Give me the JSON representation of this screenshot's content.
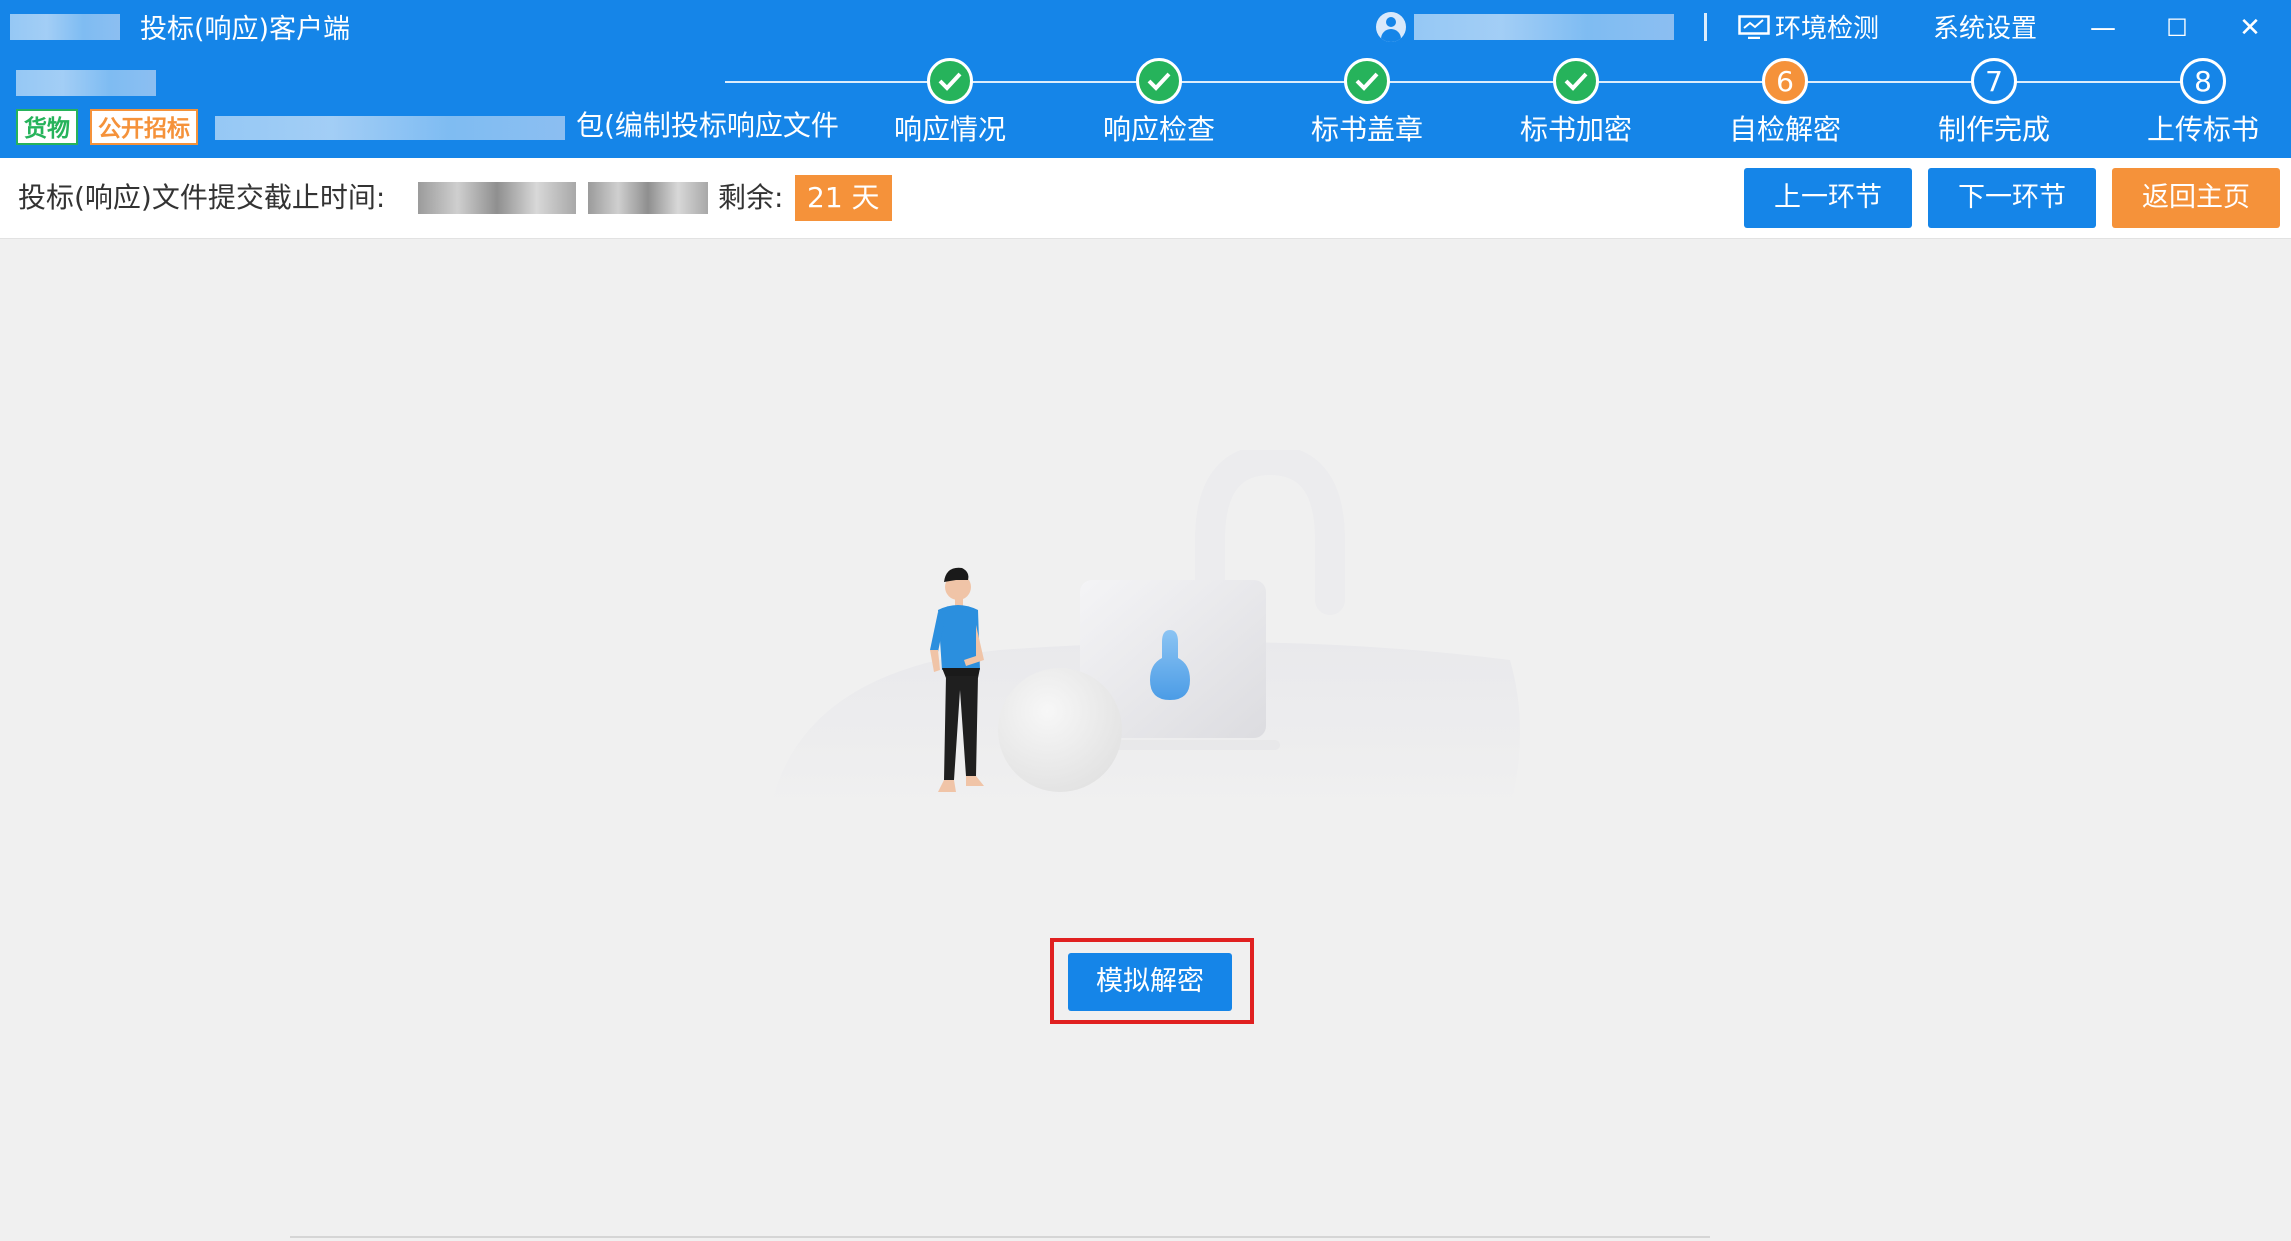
{
  "window": {
    "title": "投标(响应)客户端",
    "menu": {
      "env_check": "环境检测",
      "settings": "系统设置"
    },
    "controls": {
      "minimize": "—",
      "maximize": "☐",
      "close": "✕"
    }
  },
  "tags": {
    "category": "货物",
    "method": "公开招标"
  },
  "project_suffix": "包(编制投标响应文件",
  "steps": [
    {
      "label": "响应情况",
      "status": "done"
    },
    {
      "label": "响应检查",
      "status": "done"
    },
    {
      "label": "标书盖章",
      "status": "done"
    },
    {
      "label": "标书加密",
      "status": "done"
    },
    {
      "label": "自检解密",
      "status": "active",
      "number": "6"
    },
    {
      "label": "制作完成",
      "status": "todo",
      "number": "7"
    },
    {
      "label": "上传标书",
      "status": "todo",
      "number": "8"
    }
  ],
  "infobar": {
    "deadline_label": "投标(响应)文件提交截止时间:",
    "remaining_label": "剩余:",
    "remaining_value": "21 天",
    "prev_button": "上一环节",
    "next_button": "下一环节",
    "home_button": "返回主页"
  },
  "main": {
    "action_button": "模拟解密"
  },
  "colors": {
    "primary": "#1585e8",
    "success": "#26b35b",
    "warning": "#f5923a",
    "highlight": "#e02020"
  }
}
